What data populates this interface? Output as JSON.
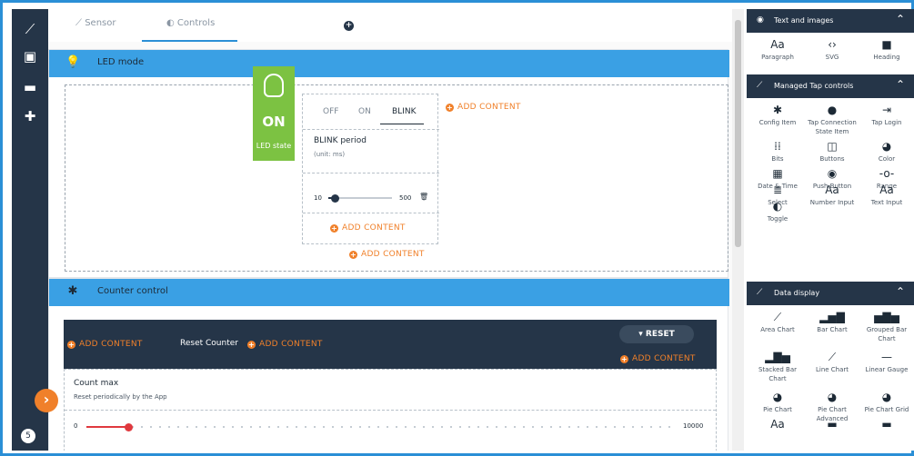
{
  "tabs": [
    {
      "icon": "sensor-icon",
      "label": "Sensor"
    },
    {
      "icon": "controls-icon",
      "label": "Controls"
    }
  ],
  "led_card": {
    "title": "LED mode",
    "led_state": "ON",
    "led_label": "LED state",
    "modes": [
      "OFF",
      "ON",
      "BLINK"
    ],
    "selected_mode": "BLINK",
    "blink_title": "BLINK period",
    "blink_unit": "(unit: ms)",
    "slider_min": "10",
    "slider_max": "500",
    "slider_level": 0.1,
    "add_content": "ADD CONTENT"
  },
  "counter_card": {
    "title": "Counter control",
    "reset_counter": "Reset Counter",
    "reset_button": "RESET",
    "count_max_title": "Count max",
    "count_max_sub": "Reset periodically by the App",
    "slider_min": "0",
    "slider_max": "10000",
    "slider_level": 0.07,
    "add_content": "ADD CONTENT"
  },
  "nav_badge": "5",
  "sidebar": {
    "sections": [
      {
        "title": "Text and images",
        "items": [
          {
            "label": "Paragraph",
            "icon": "Aa"
          },
          {
            "label": "SVG",
            "icon": "‹›"
          },
          {
            "label": "Heading",
            "icon": "■"
          }
        ]
      },
      {
        "title": "Managed Tap controls",
        "items": [
          {
            "label": "Config Item",
            "icon": "✱"
          },
          {
            "label": "Tap Connection State Item",
            "icon": "●"
          },
          {
            "label": "Tap Login",
            "icon": "⇥"
          },
          {
            "label": "Bits",
            "icon": "⁞⁞"
          },
          {
            "label": "Buttons",
            "icon": "◫"
          },
          {
            "label": "Color",
            "icon": "◕"
          },
          {
            "label": "Date & Time",
            "icon": "▦"
          },
          {
            "label": "Push Button",
            "icon": "◉"
          },
          {
            "label": "Range",
            "icon": "-o-"
          },
          {
            "label": "Select",
            "icon": "≣"
          },
          {
            "label": "Number Input",
            "icon": "Aa"
          },
          {
            "label": "Text Input",
            "icon": "Aa"
          },
          {
            "label": "Toggle",
            "icon": "◐"
          }
        ]
      },
      {
        "title": "Data display",
        "items": [
          {
            "label": "Area Chart",
            "icon": "⟋"
          },
          {
            "label": "Bar Chart",
            "icon": "▂▅▇"
          },
          {
            "label": "Grouped Bar Chart",
            "icon": "▅▇▅"
          },
          {
            "label": "Stacked Bar Chart",
            "icon": "▂▇▅"
          },
          {
            "label": "Line Chart",
            "icon": "⟋"
          },
          {
            "label": "Linear Gauge",
            "icon": "—"
          },
          {
            "label": "Pie Chart",
            "icon": "◕"
          },
          {
            "label": "Pie Chart Advanced",
            "icon": "◕"
          },
          {
            "label": "Pie Chart Grid",
            "icon": "◕"
          },
          {
            "label": "",
            "icon": "Aa"
          },
          {
            "label": "",
            "icon": "▬"
          },
          {
            "label": "",
            "icon": "▬"
          }
        ]
      }
    ]
  },
  "colors": {
    "accent_blue": "#3aa0e4",
    "dark_navy": "#253548",
    "orange": "#f0802a",
    "led_green": "#7cc242"
  }
}
